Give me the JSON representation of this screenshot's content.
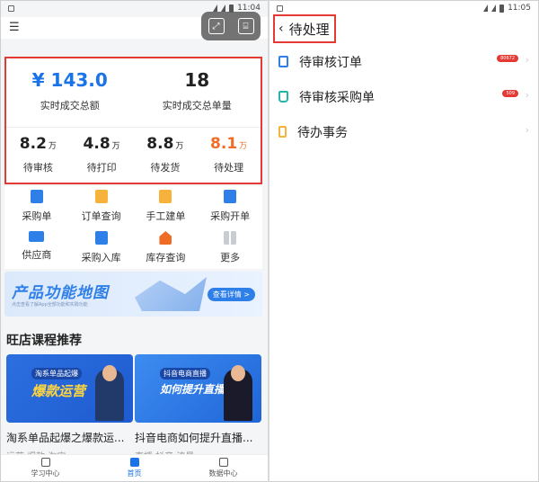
{
  "left_status": {
    "time": "11:04"
  },
  "right_status": {
    "time": "11:05"
  },
  "stats": {
    "amount": {
      "value": "¥ 143.0",
      "label": "实时成交总额"
    },
    "count": {
      "value": "18",
      "label": "实时成交总单量"
    },
    "small": [
      {
        "value": "8.2",
        "unit": "万",
        "label": "待审核"
      },
      {
        "value": "4.8",
        "unit": "万",
        "label": "待打印"
      },
      {
        "value": "8.8",
        "unit": "万",
        "label": "待发货"
      },
      {
        "value": "8.1",
        "unit": "万",
        "label": "待处理"
      }
    ]
  },
  "grid": [
    {
      "label": "采购单",
      "icon": "purchase-order-icon",
      "color": "#2f7fe8"
    },
    {
      "label": "订单查询",
      "icon": "order-query-icon",
      "color": "#f6b23a"
    },
    {
      "label": "手工建单",
      "icon": "manual-create-icon",
      "color": "#f6b23a"
    },
    {
      "label": "采购开单",
      "icon": "purchase-bag-icon",
      "color": "#2f7fe8"
    },
    {
      "label": "供应商",
      "icon": "supplier-truck-icon",
      "color": "#2f7fe8"
    },
    {
      "label": "采购入库",
      "icon": "purchase-inbound-icon",
      "color": "#2f7fe8"
    },
    {
      "label": "库存查询",
      "icon": "inventory-house-icon",
      "color": "#ef6c27"
    },
    {
      "label": "更多",
      "icon": "more-grid-icon",
      "color": "#c9ccd2"
    }
  ],
  "banner": {
    "title": "产品功能地图",
    "subtitle": "点击查看了解App全部功能和实践功能",
    "button": "查看详情 >"
  },
  "section_title": "旺店课程推荐",
  "courses": [
    {
      "tag": "淘系单品起爆",
      "title": "爆款运营",
      "name": "淘系单品起爆之爆款运...",
      "tags": "运营 爆款 淘宝"
    },
    {
      "tag": "抖音电商直播",
      "title": "如何提升直播效果",
      "name": "抖音电商如何提升直播...",
      "tags": "直播 抖音 流量"
    }
  ],
  "tabs": [
    {
      "label": "学习中心",
      "icon": "study-center-icon"
    },
    {
      "label": "首页",
      "icon": "home-icon"
    },
    {
      "label": "数据中心",
      "icon": "data-center-icon"
    }
  ],
  "right": {
    "title": "待处理",
    "items": [
      {
        "label": "待审核订单",
        "badge": "80672",
        "icon": "clipboard-icon",
        "color": "#2f7fe8"
      },
      {
        "label": "待审核采购单",
        "badge": "509",
        "icon": "basket-icon",
        "color": "#26b4a8"
      },
      {
        "label": "待办事务",
        "badge": "",
        "icon": "bookmark-icon",
        "color": "#f6b23a"
      }
    ]
  }
}
